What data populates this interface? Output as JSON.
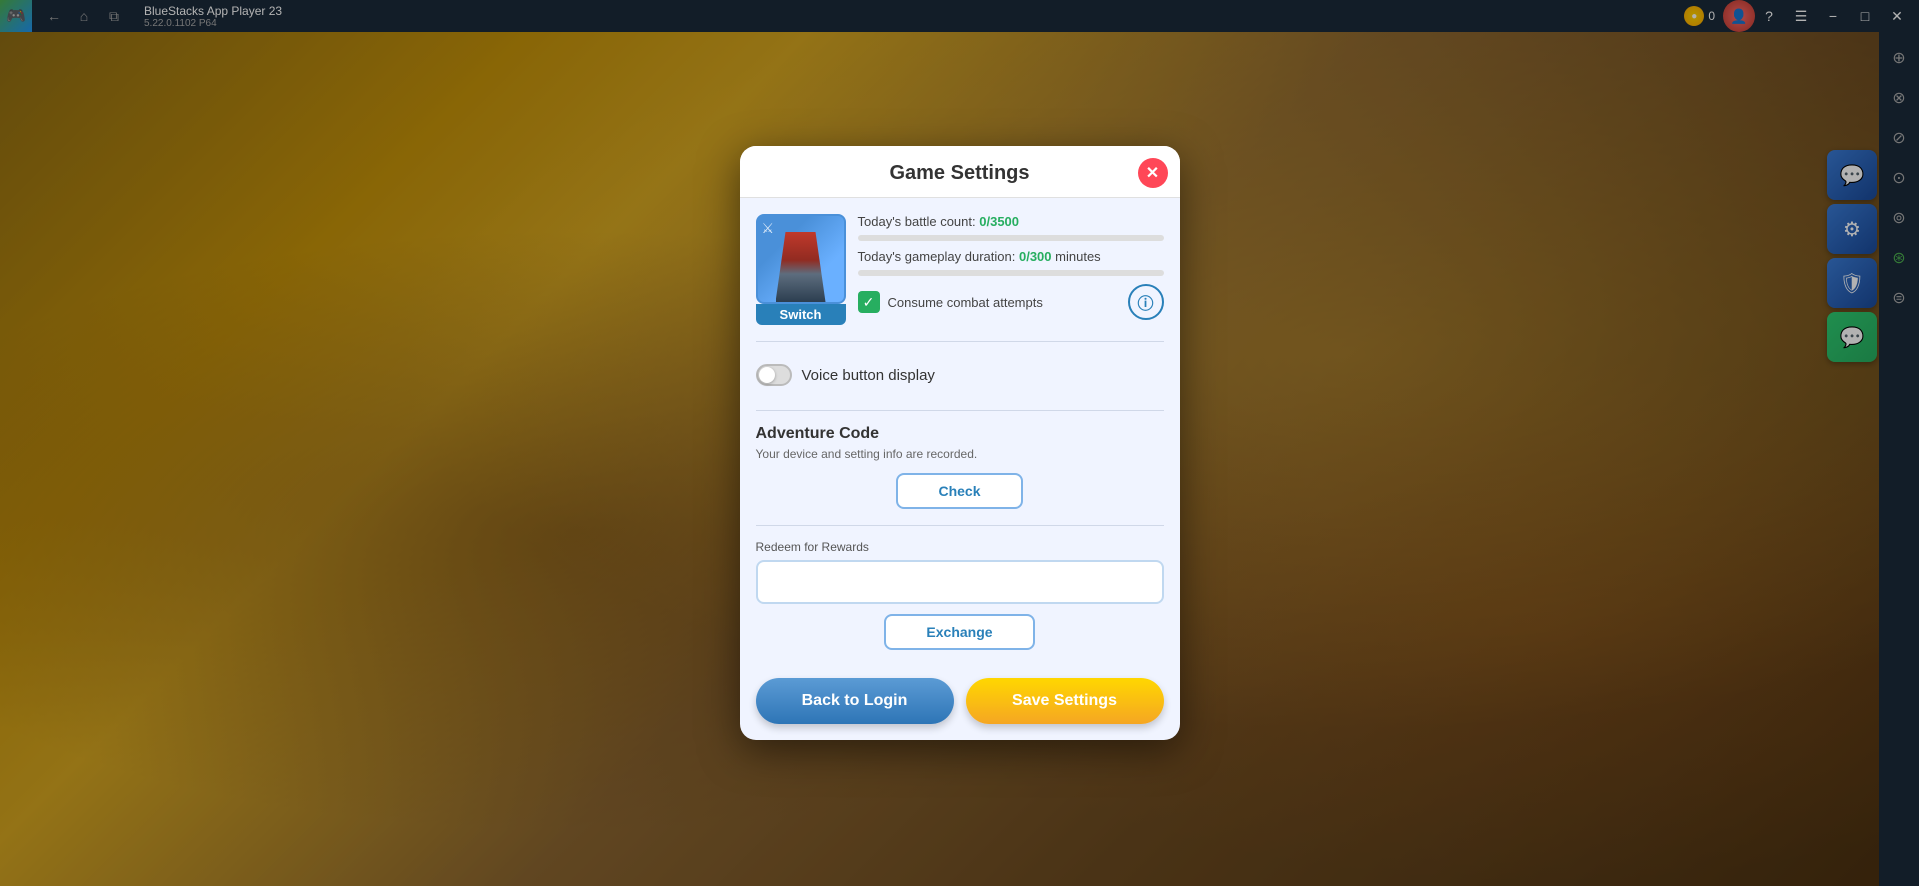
{
  "titlebar": {
    "app_name": "BlueStacks App Player 23",
    "version": "5.22.0.1102  P64",
    "logo_icon": "🎮",
    "coins": "0",
    "nav_back": "←",
    "nav_home": "⌂",
    "nav_copy": "⧉",
    "ctrl_question": "?",
    "ctrl_menu": "☰",
    "ctrl_minimize": "−",
    "ctrl_maximize": "□",
    "ctrl_close": "✕"
  },
  "right_sidebar": {
    "icons": [
      "⊕",
      "⊗",
      "⊘",
      "⊙",
      "⊚",
      "⊛",
      "⊜"
    ]
  },
  "dialog": {
    "title": "Game Settings",
    "close_label": "✕",
    "avatar_label": "Switch",
    "battle_count_label": "Today's battle count:",
    "battle_count_value": "0/3500",
    "gameplay_duration_label": "Today's gameplay duration:",
    "gameplay_duration_value": "0/300",
    "gameplay_duration_unit": "minutes",
    "consume_label": "Consume combat attempts",
    "voice_button_label": "Voice button display",
    "adventure_code_title": "Adventure Code",
    "adventure_code_desc": "Your device and setting info are recorded.",
    "check_label": "Check",
    "redeem_label": "Redeem for Rewards",
    "redeem_placeholder": "",
    "exchange_label": "Exchange",
    "back_to_login_label": "Back to Login",
    "save_settings_label": "Save Settings"
  }
}
